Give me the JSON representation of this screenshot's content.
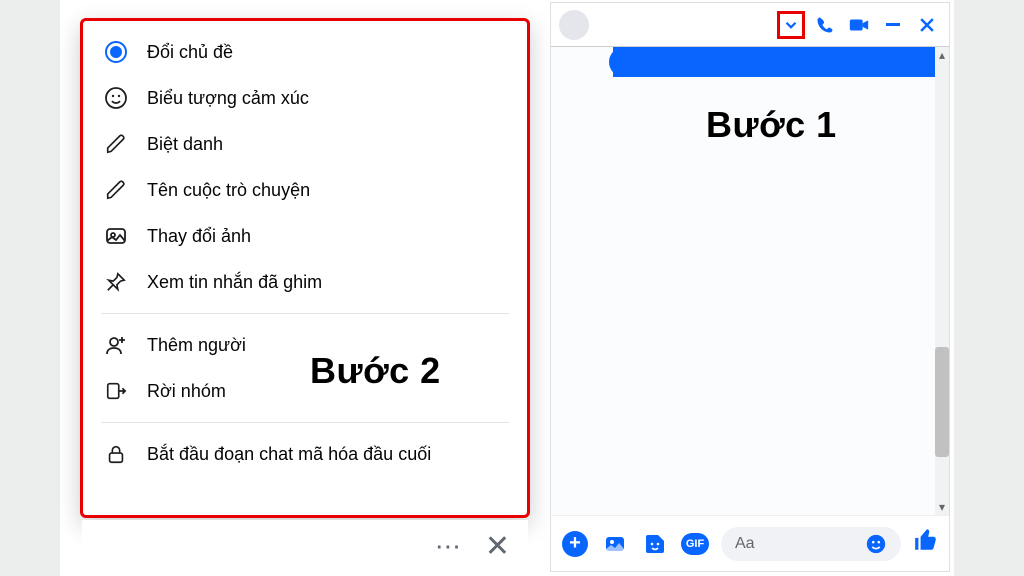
{
  "annotations": {
    "step1": "Bước 1",
    "step2": "Bước 2"
  },
  "menu": {
    "items": [
      {
        "id": "change-theme",
        "label": "Đổi chủ đề",
        "icon": "radio-active"
      },
      {
        "id": "change-emoji",
        "label": "Biểu tượng cảm xúc",
        "icon": "smile"
      },
      {
        "id": "nicknames",
        "label": "Biệt danh",
        "icon": "pencil"
      },
      {
        "id": "chat-name",
        "label": "Tên cuộc trò chuyện",
        "icon": "pencil"
      },
      {
        "id": "change-photo",
        "label": "Thay đổi ảnh",
        "icon": "image"
      },
      {
        "id": "pinned-messages",
        "label": "Xem tin nhắn đã ghim",
        "icon": "pin"
      }
    ],
    "group_items": [
      {
        "id": "add-people",
        "label": "Thêm người",
        "icon": "person-plus"
      },
      {
        "id": "leave-group",
        "label": "Rời nhóm",
        "icon": "leave"
      }
    ],
    "security_items": [
      {
        "id": "e2e-chat",
        "label": "Bắt đầu đoạn chat mã hóa đầu cuối",
        "icon": "lock"
      }
    ]
  },
  "chat_header": {
    "icons": {
      "caret": "chevron-down",
      "voice": "phone",
      "video": "video-camera",
      "minimize": "minimize",
      "close": "close"
    }
  },
  "composer": {
    "placeholder": "Aa",
    "icons": {
      "add": "plus-circle",
      "image": "image-gallery",
      "sticker": "sticker",
      "gif_label": "GIF",
      "emoji": "smile",
      "like": "thumbs-up"
    }
  },
  "under_menu": {
    "more": "⋯",
    "close": "✕"
  }
}
